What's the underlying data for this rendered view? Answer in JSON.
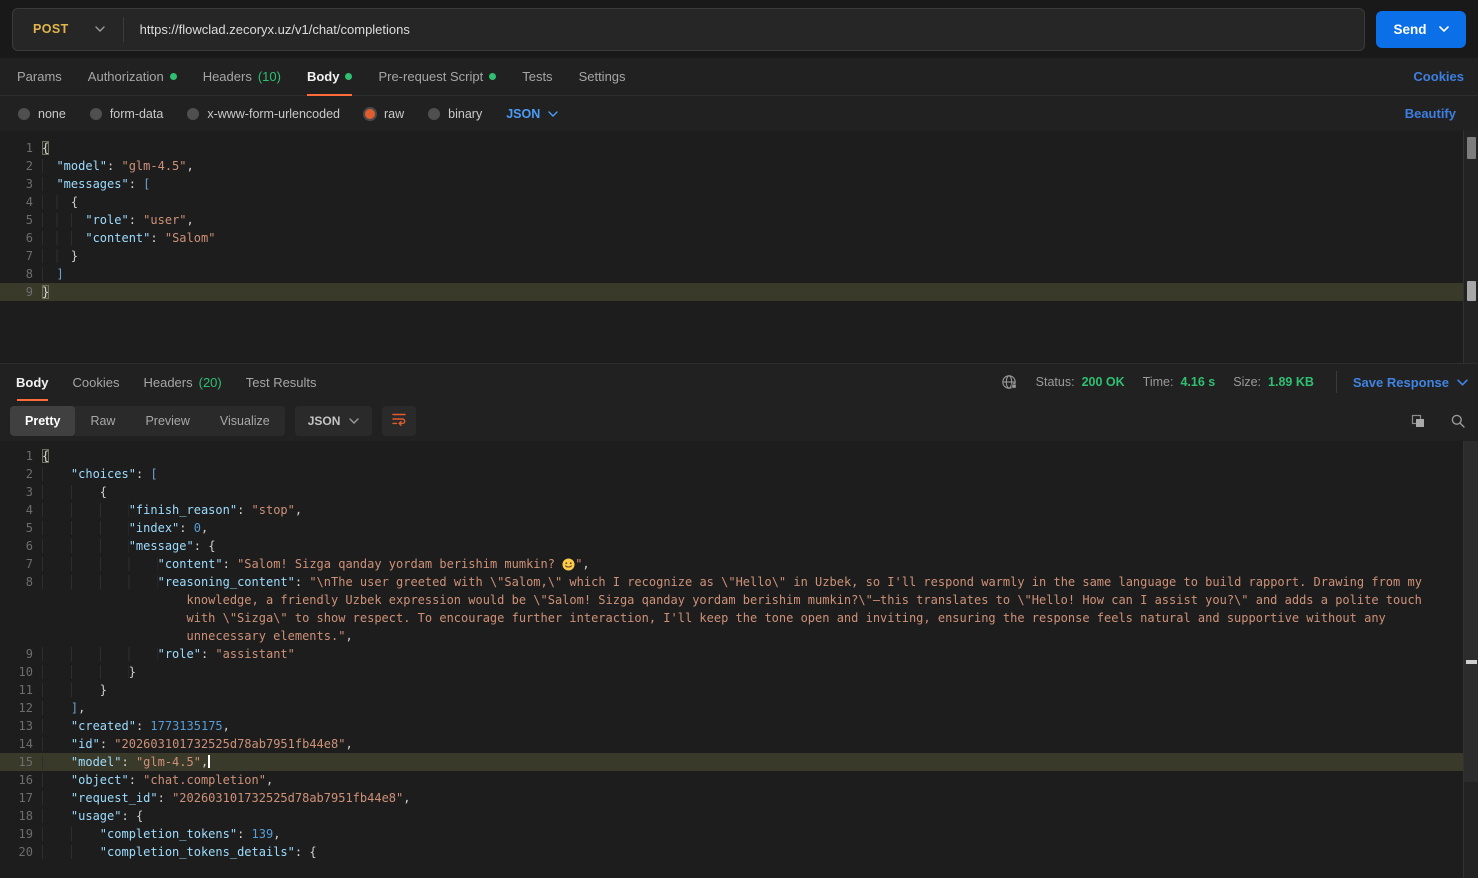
{
  "colors": {
    "accent_orange": "#ff6c37",
    "send_button_blue": "#0b6fe8",
    "link_blue": "#3d7ee0",
    "success_green": "#2fbf71",
    "method_post_gold": "#e3b64d",
    "editor_key_blue": "#9cdcfe",
    "editor_string_orange": "#ce9178",
    "current_line_olive": "#3a3a2b"
  },
  "request_bar": {
    "method": "POST",
    "url": "https://flowclad.zecoryx.uz/v1/chat/completions",
    "send_label": "Send"
  },
  "request_tabs": {
    "params": "Params",
    "authorization": "Authorization",
    "headers": "Headers",
    "headers_count": "(10)",
    "body": "Body",
    "pre_request": "Pre-request Script",
    "tests": "Tests",
    "settings": "Settings",
    "cookies_link": "Cookies"
  },
  "body_type_bar": {
    "none": "none",
    "form_data": "form-data",
    "urlencoded": "x-www-form-urlencoded",
    "raw": "raw",
    "binary": "binary",
    "format": "JSON",
    "beautify": "Beautify"
  },
  "request_editor": {
    "lines": [
      {
        "n": 1,
        "tk": [
          {
            "t": "m",
            "v": "{"
          }
        ]
      },
      {
        "n": 2,
        "tk": [
          {
            "t": "i",
            "v": "  "
          },
          {
            "t": "k",
            "v": "\"model\""
          },
          {
            "t": "p",
            "v": ": "
          },
          {
            "t": "s",
            "v": "\"glm-4.5\""
          },
          {
            "t": "p",
            "v": ","
          }
        ]
      },
      {
        "n": 3,
        "tk": [
          {
            "t": "i",
            "v": "  "
          },
          {
            "t": "k",
            "v": "\"messages\""
          },
          {
            "t": "p",
            "v": ": "
          },
          {
            "t": "b",
            "v": "["
          }
        ]
      },
      {
        "n": 4,
        "tk": [
          {
            "t": "i",
            "v": "    "
          },
          {
            "t": "p",
            "v": "{"
          }
        ]
      },
      {
        "n": 5,
        "tk": [
          {
            "t": "i",
            "v": "      "
          },
          {
            "t": "k",
            "v": "\"role\""
          },
          {
            "t": "p",
            "v": ": "
          },
          {
            "t": "s",
            "v": "\"user\""
          },
          {
            "t": "p",
            "v": ","
          }
        ]
      },
      {
        "n": 6,
        "tk": [
          {
            "t": "i",
            "v": "      "
          },
          {
            "t": "k",
            "v": "\"content\""
          },
          {
            "t": "p",
            "v": ": "
          },
          {
            "t": "s",
            "v": "\"Salom\""
          }
        ]
      },
      {
        "n": 7,
        "tk": [
          {
            "t": "i",
            "v": "    "
          },
          {
            "t": "p",
            "v": "}"
          }
        ]
      },
      {
        "n": 8,
        "tk": [
          {
            "t": "i",
            "v": "  "
          },
          {
            "t": "b",
            "v": "]"
          }
        ]
      },
      {
        "n": 9,
        "hl": true,
        "tk": [
          {
            "t": "m",
            "v": "}"
          }
        ]
      }
    ]
  },
  "response_header": {
    "body": "Body",
    "cookies": "Cookies",
    "headers": "Headers",
    "headers_count": "(20)",
    "test_results": "Test Results",
    "status_label": "Status:",
    "status_value": "200 OK",
    "time_label": "Time:",
    "time_value": "4.16 s",
    "size_label": "Size:",
    "size_value": "1.89 KB",
    "save_response": "Save Response"
  },
  "response_toolbar": {
    "pretty": "Pretty",
    "raw": "Raw",
    "preview": "Preview",
    "visualize": "Visualize",
    "format": "JSON"
  },
  "response_editor": {
    "lines": [
      {
        "n": 1,
        "tk": [
          {
            "t": "m",
            "v": "{"
          }
        ]
      },
      {
        "n": 2,
        "tk": [
          {
            "t": "i",
            "v": "    "
          },
          {
            "t": "k",
            "v": "\"choices\""
          },
          {
            "t": "p",
            "v": ": "
          },
          {
            "t": "b",
            "v": "["
          }
        ]
      },
      {
        "n": 3,
        "tk": [
          {
            "t": "i",
            "v": "        "
          },
          {
            "t": "p",
            "v": "{"
          }
        ]
      },
      {
        "n": 4,
        "tk": [
          {
            "t": "i",
            "v": "            "
          },
          {
            "t": "k",
            "v": "\"finish_reason\""
          },
          {
            "t": "p",
            "v": ": "
          },
          {
            "t": "s",
            "v": "\"stop\""
          },
          {
            "t": "p",
            "v": ","
          }
        ]
      },
      {
        "n": 5,
        "tk": [
          {
            "t": "i",
            "v": "            "
          },
          {
            "t": "k",
            "v": "\"index\""
          },
          {
            "t": "p",
            "v": ": "
          },
          {
            "t": "n",
            "v": "0"
          },
          {
            "t": "p",
            "v": ","
          }
        ]
      },
      {
        "n": 6,
        "tk": [
          {
            "t": "i",
            "v": "            "
          },
          {
            "t": "k",
            "v": "\"message\""
          },
          {
            "t": "p",
            "v": ": "
          },
          {
            "t": "p",
            "v": "{"
          }
        ]
      },
      {
        "n": 7,
        "tk": [
          {
            "t": "i",
            "v": "                "
          },
          {
            "t": "k",
            "v": "\"content\""
          },
          {
            "t": "p",
            "v": ": "
          },
          {
            "t": "s",
            "v": "\"Salom! Sizga qanday yordam berishim mumkin? "
          },
          {
            "t": "e",
            "v": "smiling-face-emoji"
          },
          {
            "t": "s",
            "v": "\""
          },
          {
            "t": "p",
            "v": ","
          }
        ]
      },
      {
        "n": 8,
        "hang": true,
        "tk": [
          {
            "t": "i",
            "v": "                "
          },
          {
            "t": "k",
            "v": "\"reasoning_content\""
          },
          {
            "t": "p",
            "v": ": "
          },
          {
            "t": "s",
            "v": "\"\\nThe user greeted with \\\"Salom,\\\" which I recognize as \\\"Hello\\\" in Uzbek, so I'll respond warmly in the same language to build rapport. Drawing from my knowledge, a friendly Uzbek expression would be \\\"Salom! Sizga qanday yordam berishim mumkin?\\\"—this translates to \\\"Hello! How can I assist you?\\\" and adds a polite touch with \\\"Sizga\\\" to show respect. To encourage further interaction, I'll keep the tone open and inviting, ensuring the response feels natural and supportive without any unnecessary elements.\""
          },
          {
            "t": "p",
            "v": ","
          }
        ]
      },
      {
        "n": 9,
        "tk": [
          {
            "t": "i",
            "v": "                "
          },
          {
            "t": "k",
            "v": "\"role\""
          },
          {
            "t": "p",
            "v": ": "
          },
          {
            "t": "s",
            "v": "\"assistant\""
          }
        ]
      },
      {
        "n": 10,
        "tk": [
          {
            "t": "i",
            "v": "            "
          },
          {
            "t": "p",
            "v": "}"
          }
        ]
      },
      {
        "n": 11,
        "tk": [
          {
            "t": "i",
            "v": "        "
          },
          {
            "t": "p",
            "v": "}"
          }
        ]
      },
      {
        "n": 12,
        "tk": [
          {
            "t": "i",
            "v": "    "
          },
          {
            "t": "b",
            "v": "]"
          },
          {
            "t": "p",
            "v": ","
          }
        ]
      },
      {
        "n": 13,
        "tk": [
          {
            "t": "i",
            "v": "    "
          },
          {
            "t": "k",
            "v": "\"created\""
          },
          {
            "t": "p",
            "v": ": "
          },
          {
            "t": "n",
            "v": "1773135175"
          },
          {
            "t": "p",
            "v": ","
          }
        ]
      },
      {
        "n": 14,
        "tk": [
          {
            "t": "i",
            "v": "    "
          },
          {
            "t": "k",
            "v": "\"id\""
          },
          {
            "t": "p",
            "v": ": "
          },
          {
            "t": "s",
            "v": "\"202603101732525d78ab7951fb44e8\""
          },
          {
            "t": "p",
            "v": ","
          }
        ]
      },
      {
        "n": 15,
        "hl": true,
        "tk": [
          {
            "t": "i",
            "v": "    "
          },
          {
            "t": "k",
            "v": "\"model\""
          },
          {
            "t": "p",
            "v": ": "
          },
          {
            "t": "s",
            "v": "\"glm-4.5\""
          },
          {
            "t": "p",
            "v": ","
          },
          {
            "t": "c",
            "v": ""
          }
        ]
      },
      {
        "n": 16,
        "tk": [
          {
            "t": "i",
            "v": "    "
          },
          {
            "t": "k",
            "v": "\"object\""
          },
          {
            "t": "p",
            "v": ": "
          },
          {
            "t": "s",
            "v": "\"chat.completion\""
          },
          {
            "t": "p",
            "v": ","
          }
        ]
      },
      {
        "n": 17,
        "tk": [
          {
            "t": "i",
            "v": "    "
          },
          {
            "t": "k",
            "v": "\"request_id\""
          },
          {
            "t": "p",
            "v": ": "
          },
          {
            "t": "s",
            "v": "\"202603101732525d78ab7951fb44e8\""
          },
          {
            "t": "p",
            "v": ","
          }
        ]
      },
      {
        "n": 18,
        "tk": [
          {
            "t": "i",
            "v": "    "
          },
          {
            "t": "k",
            "v": "\"usage\""
          },
          {
            "t": "p",
            "v": ": "
          },
          {
            "t": "p",
            "v": "{"
          }
        ]
      },
      {
        "n": 19,
        "tk": [
          {
            "t": "i",
            "v": "        "
          },
          {
            "t": "k",
            "v": "\"completion_tokens\""
          },
          {
            "t": "p",
            "v": ": "
          },
          {
            "t": "n",
            "v": "139"
          },
          {
            "t": "p",
            "v": ","
          }
        ]
      },
      {
        "n": 20,
        "tk": [
          {
            "t": "i",
            "v": "        "
          },
          {
            "t": "k",
            "v": "\"completion_tokens_details\""
          },
          {
            "t": "p",
            "v": ": "
          },
          {
            "t": "p",
            "v": "{"
          }
        ]
      }
    ]
  }
}
